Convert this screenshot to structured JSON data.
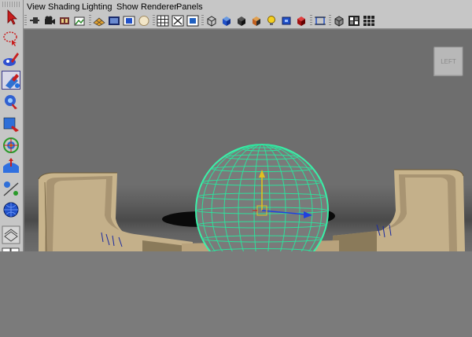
{
  "menubar": {
    "items": [
      "View",
      "Shading",
      "Lighting",
      "Show",
      "Renderer",
      "Panels"
    ]
  },
  "viewcube": {
    "label": "LEFT"
  },
  "toolbox": {
    "tools": [
      "select-tool",
      "lasso-tool",
      "paint-select-tool",
      "move-tool",
      "rotate-tool",
      "scale-tool",
      "universal-manipulator-tool",
      "soft-modification-tool",
      "show-manipulator-tool",
      "last-tool-used",
      "single-perspective-layout",
      "four-view-layout"
    ]
  },
  "colors": {
    "ui_gray": "#c6c6c6",
    "viewport_bg": "#6e6e6e",
    "wireframe": "#33e0a0",
    "half_pipe": "#b9a47e"
  }
}
